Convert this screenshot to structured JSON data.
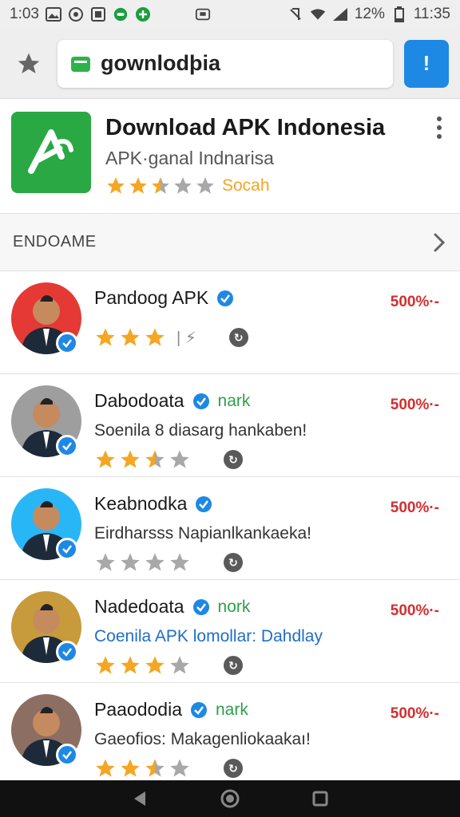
{
  "status_bar": {
    "time_left": "1:03",
    "battery": "12%",
    "time_right": "11:35"
  },
  "toolbar": {
    "url": "gownlodþia",
    "alert_label": "!"
  },
  "app": {
    "title": "Download APK Indonesia",
    "subtitle": "APK·ganal Indnarisa",
    "rating_label": "Socah",
    "stars_filled": 2.5,
    "stars_total": 5
  },
  "section": {
    "title": "ENDOAME"
  },
  "items": [
    {
      "title": "Pandoog APK",
      "tag": "",
      "desc": "",
      "price": "500%·-",
      "stars_filled": 3,
      "stars_total": 3,
      "extra": "| ⚡",
      "avatar_color": "#e53935"
    },
    {
      "title": "Dabodoata",
      "tag": "nark",
      "desc": "Soenila 8 diasarg hankaben!",
      "price": "500%·-",
      "stars_filled": 2.5,
      "stars_total": 4,
      "avatar_color": "#9e9e9e"
    },
    {
      "title": "Keabnodka",
      "tag": "",
      "desc": "Eirdharsss Napianlkankaeka!",
      "price": "500%·-",
      "stars_filled": 0,
      "stars_total": 4,
      "avatar_color": "#29b6f6"
    },
    {
      "title": "Nadedoata",
      "tag": "nork",
      "desc": "Coenila APK lomollar: Dahdlay",
      "price": "500%·-",
      "stars_filled": 3,
      "stars_total": 4,
      "avatar_color": "#c79a3c",
      "desc_blue": true
    },
    {
      "title": "Paaododia",
      "tag": "nark",
      "desc": "Gaeofios: Makagenliokaakaı!",
      "price": "500%·-",
      "stars_filled": 2.5,
      "stars_total": 4,
      "avatar_color": "#8d6e63"
    }
  ],
  "colors": {
    "accent": "#1e88e5",
    "star": "#f5a623",
    "price": "#d32f2f",
    "tag": "#2e9e4a",
    "logo": "#29a843"
  }
}
